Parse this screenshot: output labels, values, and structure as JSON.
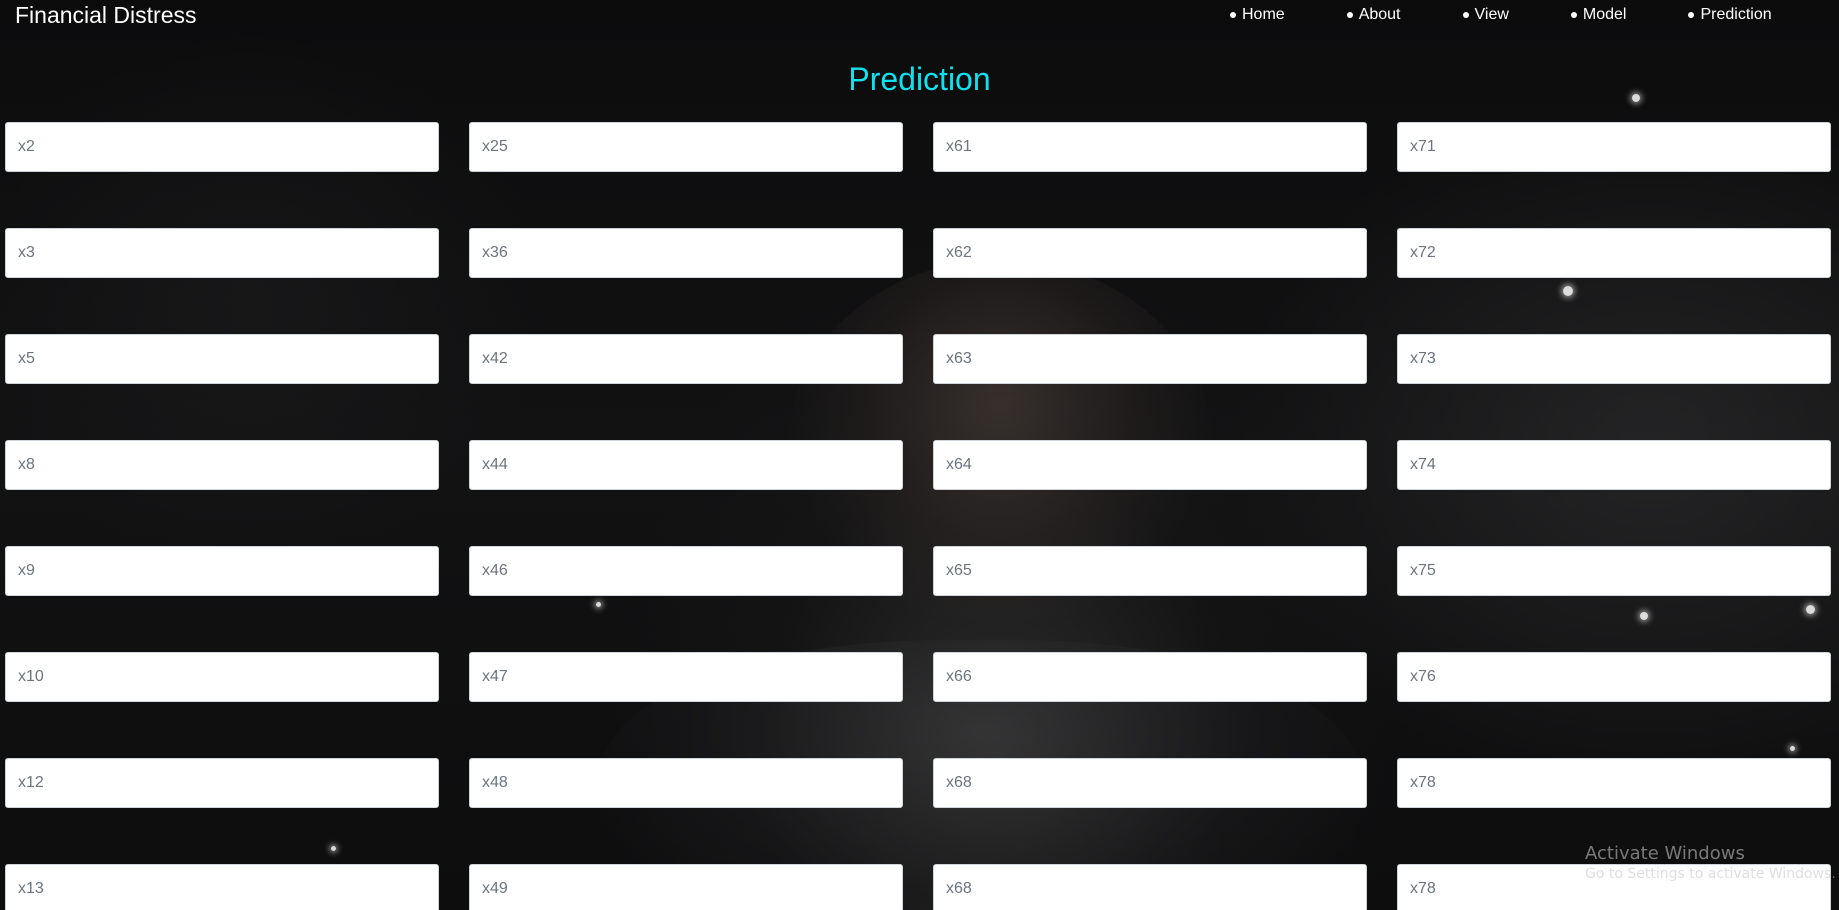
{
  "navbar": {
    "brand": "Financial Distress",
    "links": [
      {
        "label": "Home"
      },
      {
        "label": "About"
      },
      {
        "label": "View"
      },
      {
        "label": "Model"
      },
      {
        "label": "Prediction"
      }
    ]
  },
  "page": {
    "title": "Prediction",
    "title_color": "#11e1ee"
  },
  "form": {
    "fields": [
      {
        "placeholder": "x2"
      },
      {
        "placeholder": "x25"
      },
      {
        "placeholder": "x61"
      },
      {
        "placeholder": "x71"
      },
      {
        "placeholder": "x3"
      },
      {
        "placeholder": "x36"
      },
      {
        "placeholder": "x62"
      },
      {
        "placeholder": "x72"
      },
      {
        "placeholder": "x5"
      },
      {
        "placeholder": "x42"
      },
      {
        "placeholder": "x63"
      },
      {
        "placeholder": "x73"
      },
      {
        "placeholder": "x8"
      },
      {
        "placeholder": "x44"
      },
      {
        "placeholder": "x64"
      },
      {
        "placeholder": "x74"
      },
      {
        "placeholder": "x9"
      },
      {
        "placeholder": "x46"
      },
      {
        "placeholder": "x65"
      },
      {
        "placeholder": "x75"
      },
      {
        "placeholder": "x10"
      },
      {
        "placeholder": "x47"
      },
      {
        "placeholder": "x66"
      },
      {
        "placeholder": "x76"
      },
      {
        "placeholder": "x12"
      },
      {
        "placeholder": "x48"
      },
      {
        "placeholder": "x68"
      },
      {
        "placeholder": "x78"
      },
      {
        "placeholder": "x13"
      },
      {
        "placeholder": "x49"
      },
      {
        "placeholder": "x68"
      },
      {
        "placeholder": "x78"
      }
    ]
  },
  "watermark": {
    "title": "Activate Windows",
    "subtitle": "Go to Settings to activate Windows."
  }
}
